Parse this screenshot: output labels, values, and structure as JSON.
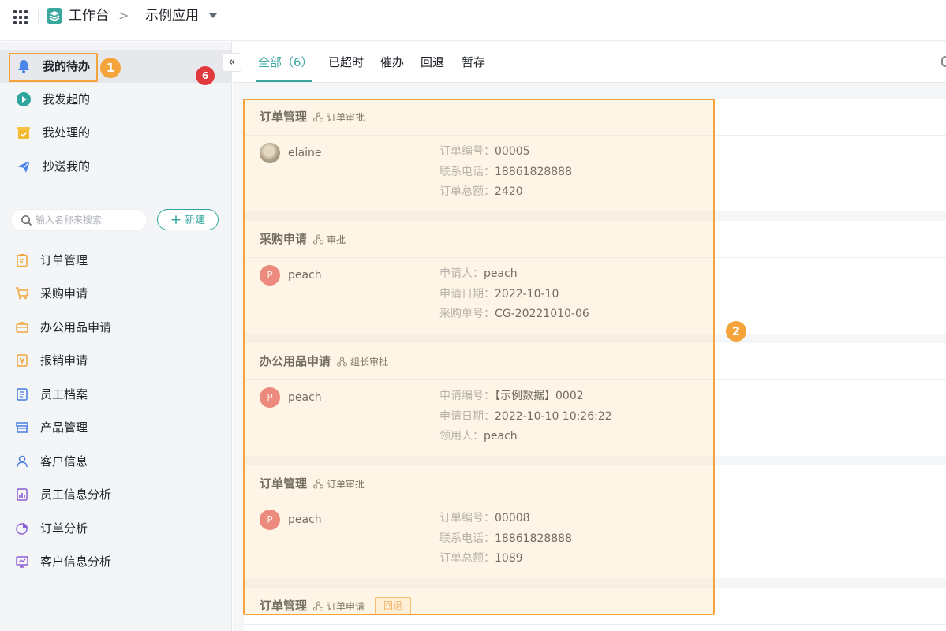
{
  "topbar": {
    "app_title": "工作台",
    "breadcrumb_sep": ">",
    "current_app": "示例应用"
  },
  "sidebar": {
    "nav": [
      {
        "label": "我的待办",
        "icon": "bell-icon",
        "active": true,
        "badge": "6"
      },
      {
        "label": "我发起的",
        "icon": "play-circle-icon"
      },
      {
        "label": "我处理的",
        "icon": "inbox-check-icon"
      },
      {
        "label": "抄送我的",
        "icon": "paper-plane-icon"
      }
    ],
    "collapse_icon": "«",
    "search_placeholder": "输入名称来搜索",
    "new_button": "新建",
    "new_button_icon": "+",
    "forms": [
      {
        "label": "订单管理",
        "icon": "clipboard-icon",
        "color": "#f0a53c"
      },
      {
        "label": "采购申请",
        "icon": "cart-icon",
        "color": "#f0a53c"
      },
      {
        "label": "办公用品申请",
        "icon": "briefcase-icon",
        "color": "#f0a53c"
      },
      {
        "label": "报销申请",
        "icon": "receipt-icon",
        "color": "#f0a53c"
      },
      {
        "label": "员工档案",
        "icon": "document-icon",
        "color": "#4a7fe0"
      },
      {
        "label": "产品管理",
        "icon": "store-icon",
        "color": "#4a7fe0"
      },
      {
        "label": "客户信息",
        "icon": "user-icon",
        "color": "#4a7fe0"
      },
      {
        "label": "员工信息分析",
        "icon": "report-icon",
        "color": "#8c5fd6"
      },
      {
        "label": "订单分析",
        "icon": "pie-chart-icon",
        "color": "#8c5fd6"
      },
      {
        "label": "客户信息分析",
        "icon": "monitor-chart-icon",
        "color": "#8c5fd6"
      }
    ]
  },
  "tabs": [
    {
      "label": "全部（6）",
      "active": true
    },
    {
      "label": "已超时"
    },
    {
      "label": "催办"
    },
    {
      "label": "回退"
    },
    {
      "label": "暂存"
    }
  ],
  "cards": [
    {
      "title": "订单管理",
      "type": "订单审批",
      "user": "elaine",
      "avatar": "photo",
      "fields": [
        {
          "k": "订单编号：",
          "v": "00005"
        },
        {
          "k": "联系电话：",
          "v": "18861828888"
        },
        {
          "k": "订单总额：",
          "v": "2420"
        }
      ]
    },
    {
      "title": "采购申请",
      "type": "审批",
      "user": "peach",
      "avatar_letter": "P",
      "fields": [
        {
          "k": "申请人：",
          "v": "peach"
        },
        {
          "k": "申请日期：",
          "v": "2022-10-10"
        },
        {
          "k": "采购单号：",
          "v": "CG-20221010-06"
        }
      ]
    },
    {
      "title": "办公用品申请",
      "type": "组长审批",
      "user": "peach",
      "avatar_letter": "P",
      "fields": [
        {
          "k": "申请编号：",
          "v": "【示例数据】0002"
        },
        {
          "k": "申请日期：",
          "v": "2022-10-10 10:26:22"
        },
        {
          "k": "领用人：",
          "v": "peach"
        }
      ]
    },
    {
      "title": "订单管理",
      "type": "订单审批",
      "user": "peach",
      "avatar_letter": "P",
      "fields": [
        {
          "k": "订单编号：",
          "v": "00008"
        },
        {
          "k": "联系电话：",
          "v": "18861828888"
        },
        {
          "k": "订单总额：",
          "v": "1089"
        }
      ]
    },
    {
      "title": "订单管理",
      "type": "订单申请",
      "status": "回退"
    }
  ],
  "annotations": {
    "marker1": "1",
    "marker2": "2"
  },
  "colors": {
    "accent": "#3aa79e",
    "highlight": "#f4a43a",
    "badge": "#e0393e",
    "avatar": "#e25456"
  }
}
